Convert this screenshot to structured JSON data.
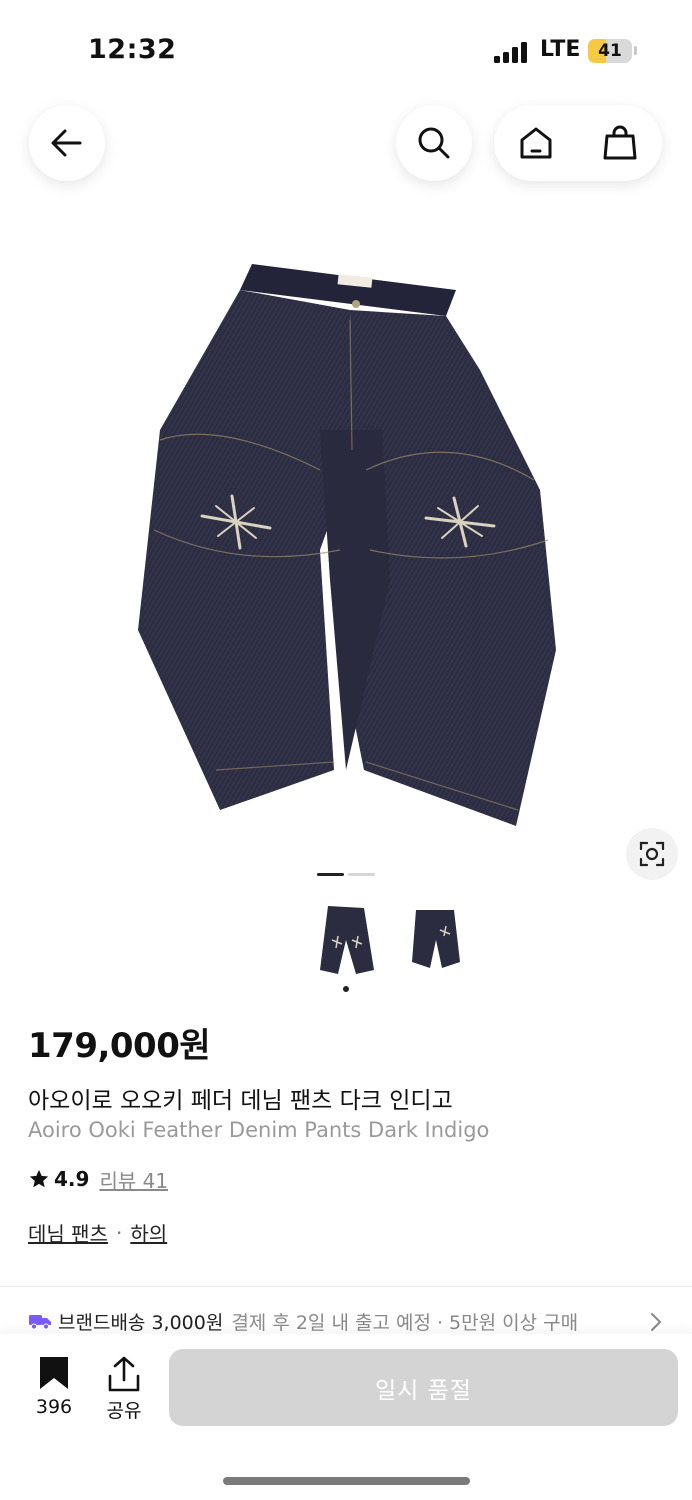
{
  "status_bar": {
    "time": "12:32",
    "network": "LTE",
    "battery": "41",
    "battery_level": 0.41
  },
  "navigation": {
    "back_icon": "arrow-left-icon",
    "search_icon": "search-icon",
    "home_icon": "home-icon",
    "cart_icon": "shopping-bag-icon"
  },
  "gallery": {
    "image_count": 2,
    "current_index": 1,
    "lens_icon": "lens-search-icon"
  },
  "product": {
    "price": "179,000원",
    "name_ko": "아오이로 오오키 페더 데님 팬츠 다크 인디고",
    "name_en": "Aoiro Ooki Feather Denim Pants Dark Indigo",
    "rating": "4.9",
    "review_label": "리뷰 41",
    "categories": [
      "데님 팬츠",
      "하의"
    ],
    "category_separator": "·"
  },
  "shipping": {
    "brand": "브랜드배송 3,000원",
    "detail": "결제 후 2일 내 출고 예정 · 5만원 이상 구매"
  },
  "bottom_bar": {
    "bookmark_count": "396",
    "share_label": "공유",
    "buy_button_label": "일시 품절"
  },
  "colors": {
    "accent": "#7a5cf5",
    "denim": "#2b2c40",
    "disabled_button": "#d4d4d4",
    "battery_fill": "#f6c945"
  }
}
